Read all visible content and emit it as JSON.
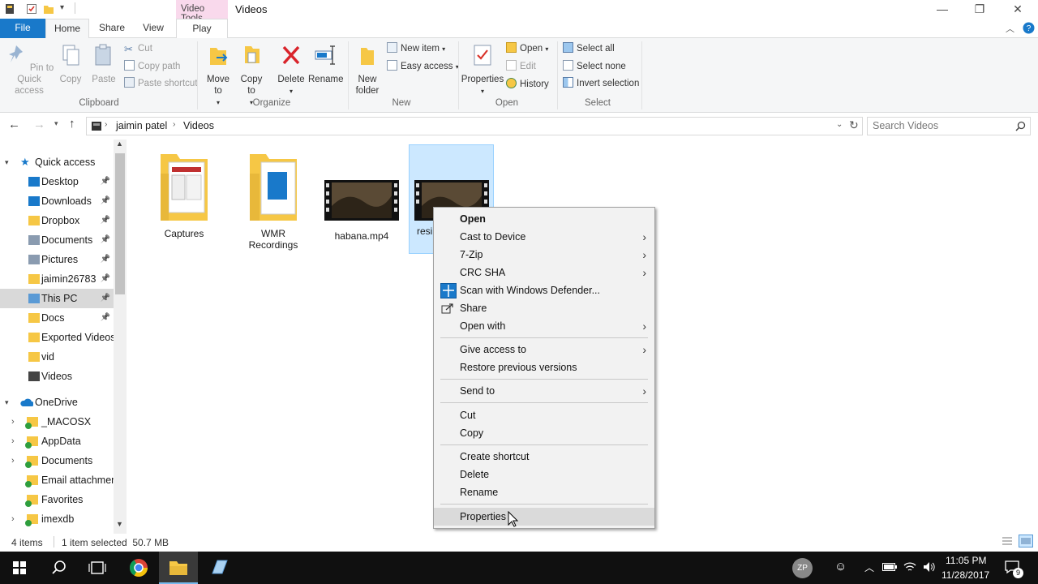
{
  "window": {
    "title": "Videos",
    "contextual_tab": "Video Tools",
    "controls": {
      "minimize": "—",
      "restore": "❐",
      "close": "✕"
    }
  },
  "tabs": {
    "file": "File",
    "home": "Home",
    "share": "Share",
    "view": "View",
    "play": "Play"
  },
  "ribbon": {
    "clipboard": {
      "label": "Clipboard",
      "pin": "Pin to Quick access",
      "copy": "Copy",
      "paste": "Paste",
      "cut": "Cut",
      "copy_path": "Copy path",
      "paste_shortcut": "Paste shortcut"
    },
    "organize": {
      "label": "Organize",
      "move_to": "Move to",
      "copy_to": "Copy to",
      "delete": "Delete",
      "rename": "Rename"
    },
    "new": {
      "label": "New",
      "new_folder": "New folder",
      "new_item": "New item",
      "easy_access": "Easy access"
    },
    "open": {
      "label": "Open",
      "properties": "Properties",
      "open": "Open",
      "edit": "Edit",
      "history": "History"
    },
    "select": {
      "label": "Select",
      "select_all": "Select all",
      "select_none": "Select none",
      "invert": "Invert selection"
    }
  },
  "address": {
    "segments": [
      "jaimin patel",
      "Videos"
    ],
    "search_placeholder": "Search Videos"
  },
  "nav": {
    "quick_access": "Quick access",
    "qa_items": [
      "Desktop",
      "Downloads",
      "Dropbox",
      "Documents",
      "Pictures",
      "jaimin26783",
      "This PC",
      "Docs",
      "Exported Videos",
      "vid",
      "Videos"
    ],
    "onedrive": "OneDrive",
    "od_items": [
      "_MACOSX",
      "AppData",
      "Documents",
      "Email attachmen",
      "Favorites",
      "imexdb"
    ]
  },
  "files": [
    {
      "name": "Captures",
      "kind": "folder"
    },
    {
      "name": "WMR Recordings",
      "kind": "folder"
    },
    {
      "name": "habana.mp4",
      "kind": "video"
    },
    {
      "name": "resi",
      "kind": "video",
      "selected": true
    }
  ],
  "context_menu": {
    "open": "Open",
    "cast": "Cast to Device",
    "zip": "7-Zip",
    "crc": "CRC SHA",
    "scan": "Scan with Windows Defender...",
    "share": "Share",
    "open_with": "Open with",
    "give_access": "Give access to",
    "restore": "Restore previous versions",
    "send_to": "Send to",
    "cut": "Cut",
    "copy": "Copy",
    "create_shortcut": "Create shortcut",
    "delete": "Delete",
    "rename": "Rename",
    "properties": "Properties"
  },
  "status": {
    "items": "4 items",
    "selected": "1 item selected  50.7 MB"
  },
  "taskbar": {
    "user_initials": "ZP",
    "time": "11:05 PM",
    "date": "11/28/2017",
    "notifications": "9"
  },
  "colors": {
    "accent": "#1979ca",
    "selection": "#cce8ff",
    "folder": "#f6c745"
  }
}
